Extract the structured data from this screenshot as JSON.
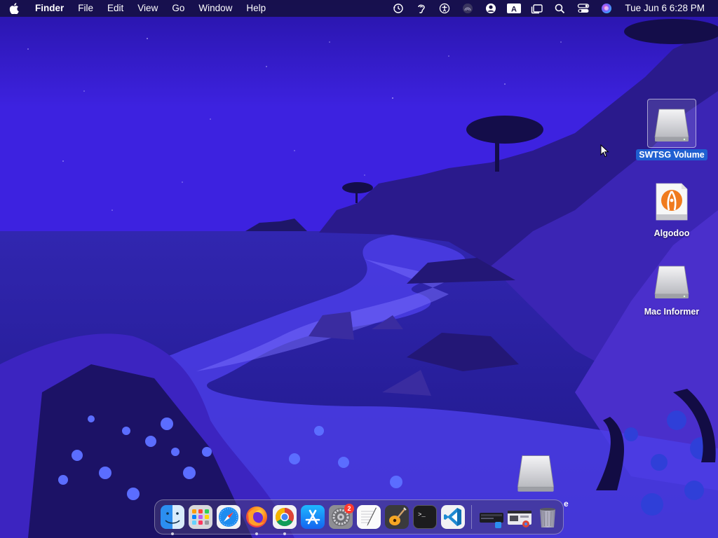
{
  "menubar": {
    "app_name": "Finder",
    "menus": [
      "File",
      "Edit",
      "View",
      "Go",
      "Window",
      "Help"
    ],
    "status_icons": [
      "time-machine-icon",
      "hearing-icon",
      "accessibility-icon",
      "screen-mirroring-icon",
      "user-icon",
      "input-source-icon",
      "stage-manager-icon",
      "search-icon",
      "control-center-icon",
      "siri-icon"
    ],
    "input_source_label": "A",
    "clock": "Tue Jun 6  6:28 PM"
  },
  "desktop": {
    "icons": [
      {
        "label": "SWTSG Volume",
        "kind": "drive",
        "selected": true
      },
      {
        "label": "Algodoo",
        "kind": "app"
      },
      {
        "label": "Mac Informer",
        "kind": "drive"
      }
    ],
    "partial_label": "e"
  },
  "dock": {
    "apps": [
      {
        "name": "Finder",
        "running": true
      },
      {
        "name": "Launchpad",
        "running": false
      },
      {
        "name": "Safari",
        "running": false
      },
      {
        "name": "Firefox",
        "running": true
      },
      {
        "name": "Google Chrome",
        "running": true
      },
      {
        "name": "App Store",
        "running": false
      },
      {
        "name": "System Preferences",
        "running": false,
        "badge": "2"
      },
      {
        "name": "TextEdit",
        "running": false
      },
      {
        "name": "GarageBand",
        "running": false
      },
      {
        "name": "Terminal",
        "running": false
      },
      {
        "name": "Visual Studio Code",
        "running": false
      }
    ],
    "terminal_prompt": ">_"
  },
  "colors": {
    "accent": "#1f5fd1",
    "badge": "#ff3b30",
    "sky": "#3a1fe0",
    "sea": "#2a1e9a"
  }
}
